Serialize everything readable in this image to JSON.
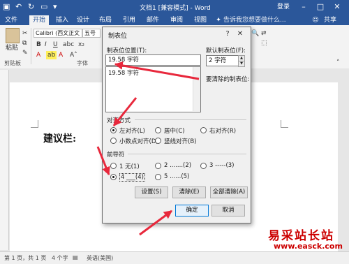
{
  "titlebar": {
    "doc_title": "文档1 [兼容模式] - Word",
    "login": "登录"
  },
  "tabs": [
    "文件",
    "开始",
    "插入",
    "设计",
    "布局",
    "引用",
    "邮件",
    "审阅",
    "视图"
  ],
  "tell_me": "告诉我您想要做什么...",
  "share": "共享",
  "ribbon": {
    "paste": "粘贴",
    "clipboard": "剪贴板",
    "font_name": "Calibri (西文正文",
    "font_size": "五号",
    "font_group": "字体",
    "bold": "B",
    "italic": "I",
    "underline": "U"
  },
  "document": {
    "text": "建议栏:"
  },
  "statusbar": {
    "page": "第 1 页，共 1 页",
    "words": "4 个字",
    "language": "英语(美国)"
  },
  "dialog": {
    "title": "制表位",
    "tab_position_label": "制表位位置(T):",
    "tab_position_value": "19.58 字符",
    "list_item": "19.58 字符",
    "default_tab_label": "默认制表位(F):",
    "default_tab_value": "2 字符",
    "to_clear_label": "要清除的制表位:",
    "alignment_label": "对齐方式",
    "align_left": "左对齐(L)",
    "align_center": "居中(C)",
    "align_right": "右对齐(R)",
    "align_decimal": "小数点对齐(D)",
    "align_bar": "竖线对齐(B)",
    "leader_label": "前导符",
    "leader_1": "1 无(1)",
    "leader_2": "2 .......(2)",
    "leader_3": "3 -----(3)",
    "leader_4": "4 ___(4)",
    "leader_5": "5 ......(5)",
    "set_button": "设置(S)",
    "clear_button": "清除(E)",
    "clear_all_button": "全部清除(A)",
    "ok_button": "确定",
    "cancel_button": "取消",
    "help": "?",
    "close": "✕"
  },
  "watermark": {
    "cn": "易采站长站",
    "url": "www.easck.com"
  },
  "colors": {
    "word_blue": "#2b579a",
    "arrow_red": "#e8283c"
  }
}
